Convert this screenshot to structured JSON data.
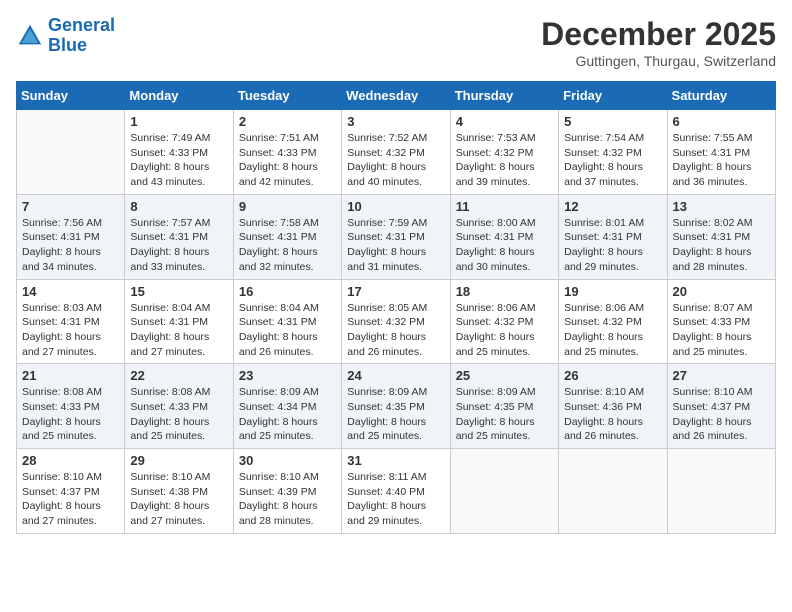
{
  "header": {
    "logo_line1": "General",
    "logo_line2": "Blue",
    "month": "December 2025",
    "location": "Guttingen, Thurgau, Switzerland"
  },
  "weekdays": [
    "Sunday",
    "Monday",
    "Tuesday",
    "Wednesday",
    "Thursday",
    "Friday",
    "Saturday"
  ],
  "weeks": [
    [
      {
        "day": "",
        "lines": []
      },
      {
        "day": "1",
        "lines": [
          "Sunrise: 7:49 AM",
          "Sunset: 4:33 PM",
          "Daylight: 8 hours",
          "and 43 minutes."
        ]
      },
      {
        "day": "2",
        "lines": [
          "Sunrise: 7:51 AM",
          "Sunset: 4:33 PM",
          "Daylight: 8 hours",
          "and 42 minutes."
        ]
      },
      {
        "day": "3",
        "lines": [
          "Sunrise: 7:52 AM",
          "Sunset: 4:32 PM",
          "Daylight: 8 hours",
          "and 40 minutes."
        ]
      },
      {
        "day": "4",
        "lines": [
          "Sunrise: 7:53 AM",
          "Sunset: 4:32 PM",
          "Daylight: 8 hours",
          "and 39 minutes."
        ]
      },
      {
        "day": "5",
        "lines": [
          "Sunrise: 7:54 AM",
          "Sunset: 4:32 PM",
          "Daylight: 8 hours",
          "and 37 minutes."
        ]
      },
      {
        "day": "6",
        "lines": [
          "Sunrise: 7:55 AM",
          "Sunset: 4:31 PM",
          "Daylight: 8 hours",
          "and 36 minutes."
        ]
      }
    ],
    [
      {
        "day": "7",
        "lines": [
          "Sunrise: 7:56 AM",
          "Sunset: 4:31 PM",
          "Daylight: 8 hours",
          "and 34 minutes."
        ]
      },
      {
        "day": "8",
        "lines": [
          "Sunrise: 7:57 AM",
          "Sunset: 4:31 PM",
          "Daylight: 8 hours",
          "and 33 minutes."
        ]
      },
      {
        "day": "9",
        "lines": [
          "Sunrise: 7:58 AM",
          "Sunset: 4:31 PM",
          "Daylight: 8 hours",
          "and 32 minutes."
        ]
      },
      {
        "day": "10",
        "lines": [
          "Sunrise: 7:59 AM",
          "Sunset: 4:31 PM",
          "Daylight: 8 hours",
          "and 31 minutes."
        ]
      },
      {
        "day": "11",
        "lines": [
          "Sunrise: 8:00 AM",
          "Sunset: 4:31 PM",
          "Daylight: 8 hours",
          "and 30 minutes."
        ]
      },
      {
        "day": "12",
        "lines": [
          "Sunrise: 8:01 AM",
          "Sunset: 4:31 PM",
          "Daylight: 8 hours",
          "and 29 minutes."
        ]
      },
      {
        "day": "13",
        "lines": [
          "Sunrise: 8:02 AM",
          "Sunset: 4:31 PM",
          "Daylight: 8 hours",
          "and 28 minutes."
        ]
      }
    ],
    [
      {
        "day": "14",
        "lines": [
          "Sunrise: 8:03 AM",
          "Sunset: 4:31 PM",
          "Daylight: 8 hours",
          "and 27 minutes."
        ]
      },
      {
        "day": "15",
        "lines": [
          "Sunrise: 8:04 AM",
          "Sunset: 4:31 PM",
          "Daylight: 8 hours",
          "and 27 minutes."
        ]
      },
      {
        "day": "16",
        "lines": [
          "Sunrise: 8:04 AM",
          "Sunset: 4:31 PM",
          "Daylight: 8 hours",
          "and 26 minutes."
        ]
      },
      {
        "day": "17",
        "lines": [
          "Sunrise: 8:05 AM",
          "Sunset: 4:32 PM",
          "Daylight: 8 hours",
          "and 26 minutes."
        ]
      },
      {
        "day": "18",
        "lines": [
          "Sunrise: 8:06 AM",
          "Sunset: 4:32 PM",
          "Daylight: 8 hours",
          "and 25 minutes."
        ]
      },
      {
        "day": "19",
        "lines": [
          "Sunrise: 8:06 AM",
          "Sunset: 4:32 PM",
          "Daylight: 8 hours",
          "and 25 minutes."
        ]
      },
      {
        "day": "20",
        "lines": [
          "Sunrise: 8:07 AM",
          "Sunset: 4:33 PM",
          "Daylight: 8 hours",
          "and 25 minutes."
        ]
      }
    ],
    [
      {
        "day": "21",
        "lines": [
          "Sunrise: 8:08 AM",
          "Sunset: 4:33 PM",
          "Daylight: 8 hours",
          "and 25 minutes."
        ]
      },
      {
        "day": "22",
        "lines": [
          "Sunrise: 8:08 AM",
          "Sunset: 4:33 PM",
          "Daylight: 8 hours",
          "and 25 minutes."
        ]
      },
      {
        "day": "23",
        "lines": [
          "Sunrise: 8:09 AM",
          "Sunset: 4:34 PM",
          "Daylight: 8 hours",
          "and 25 minutes."
        ]
      },
      {
        "day": "24",
        "lines": [
          "Sunrise: 8:09 AM",
          "Sunset: 4:35 PM",
          "Daylight: 8 hours",
          "and 25 minutes."
        ]
      },
      {
        "day": "25",
        "lines": [
          "Sunrise: 8:09 AM",
          "Sunset: 4:35 PM",
          "Daylight: 8 hours",
          "and 25 minutes."
        ]
      },
      {
        "day": "26",
        "lines": [
          "Sunrise: 8:10 AM",
          "Sunset: 4:36 PM",
          "Daylight: 8 hours",
          "and 26 minutes."
        ]
      },
      {
        "day": "27",
        "lines": [
          "Sunrise: 8:10 AM",
          "Sunset: 4:37 PM",
          "Daylight: 8 hours",
          "and 26 minutes."
        ]
      }
    ],
    [
      {
        "day": "28",
        "lines": [
          "Sunrise: 8:10 AM",
          "Sunset: 4:37 PM",
          "Daylight: 8 hours",
          "and 27 minutes."
        ]
      },
      {
        "day": "29",
        "lines": [
          "Sunrise: 8:10 AM",
          "Sunset: 4:38 PM",
          "Daylight: 8 hours",
          "and 27 minutes."
        ]
      },
      {
        "day": "30",
        "lines": [
          "Sunrise: 8:10 AM",
          "Sunset: 4:39 PM",
          "Daylight: 8 hours",
          "and 28 minutes."
        ]
      },
      {
        "day": "31",
        "lines": [
          "Sunrise: 8:11 AM",
          "Sunset: 4:40 PM",
          "Daylight: 8 hours",
          "and 29 minutes."
        ]
      },
      {
        "day": "",
        "lines": []
      },
      {
        "day": "",
        "lines": []
      },
      {
        "day": "",
        "lines": []
      }
    ]
  ]
}
